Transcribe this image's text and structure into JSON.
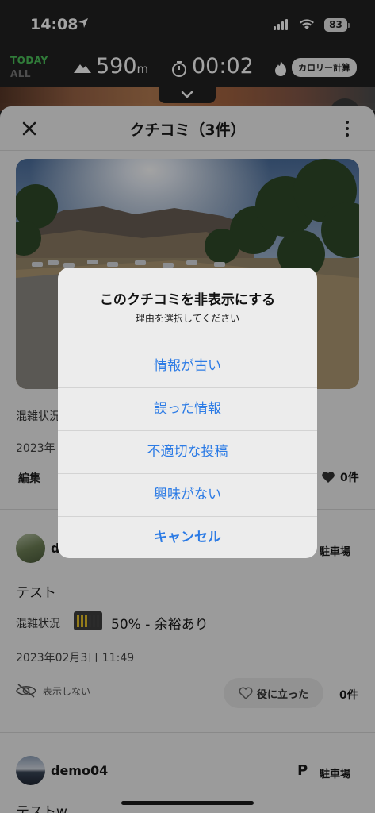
{
  "status_bar": {
    "time": "14:08",
    "battery": "83"
  },
  "stats": {
    "today_label": "TODAY",
    "all_label": "ALL",
    "elevation_value": "590",
    "elevation_unit": "m",
    "timer": "00:02",
    "calorie_button": "カロリー計算"
  },
  "sheet": {
    "title": "クチコミ（3件）"
  },
  "review1": {
    "congestion_label": "混雑状況",
    "date": "2023年",
    "edit_label": "編集",
    "likes": "0件"
  },
  "review2": {
    "user": "d",
    "tag_label": "駐車場",
    "text": "テスト",
    "congestion_label": "混雑状況",
    "congestion_value": "50% - 余裕あり",
    "congestion_level": 0.5,
    "date": "2023年02月3日 11:49",
    "hide_label": "表示しない",
    "helpful_label": "役に立った",
    "likes": "0件"
  },
  "review3": {
    "user": "demo04",
    "tag_label": "駐車場",
    "text": "テストw"
  },
  "dialog": {
    "title": "このクチコミを非表示にする",
    "message": "理由を選択してください",
    "options": [
      "情報が古い",
      "誤った情報",
      "不適切な投稿",
      "興味がない"
    ],
    "cancel": "キャンセル"
  },
  "colors": {
    "accent": "#2c7be5",
    "today_green": "#4cc05a",
    "gauge_yellow": "#e8c22a"
  }
}
